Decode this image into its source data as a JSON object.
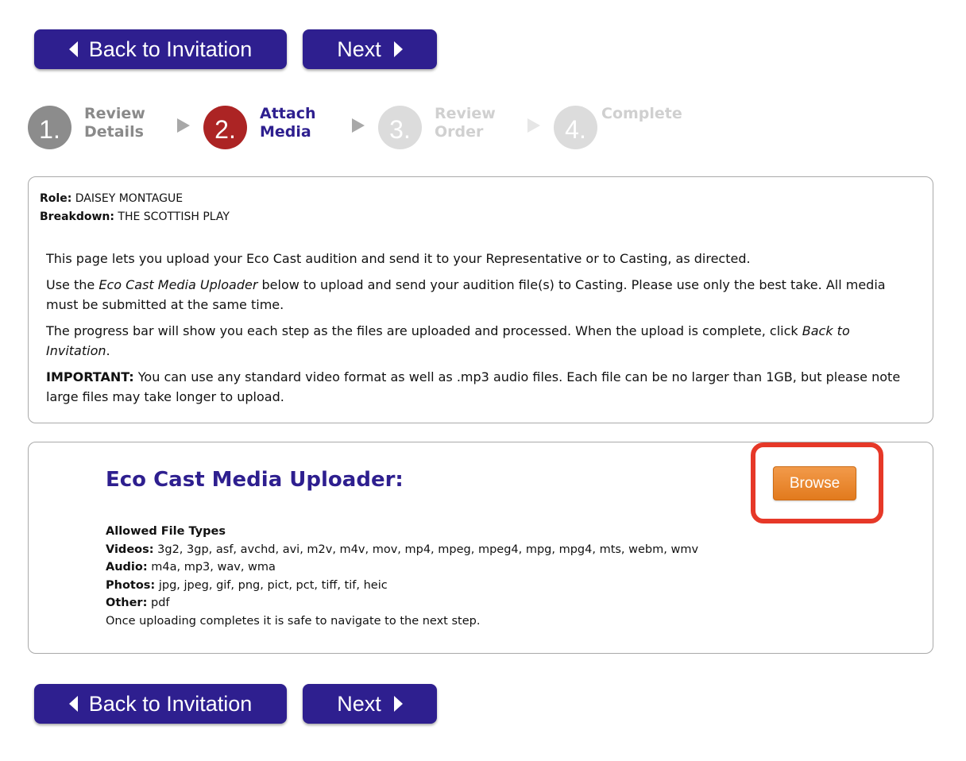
{
  "nav": {
    "back_label": "Back to Invitation",
    "next_label": "Next"
  },
  "steps": [
    {
      "number": "1.",
      "line1": "Review",
      "line2": "Details",
      "state": "done"
    },
    {
      "number": "2.",
      "line1": "Attach",
      "line2": "Media",
      "state": "active"
    },
    {
      "number": "3.",
      "line1": "Review",
      "line2": "Order",
      "state": "future"
    },
    {
      "number": "4.",
      "line1": "Complete",
      "line2": "",
      "state": "future"
    }
  ],
  "info": {
    "role_label": "Role:",
    "role_value": "DAISEY MONTAGUE",
    "breakdown_label": "Breakdown:",
    "breakdown_value": "THE SCOTTISH PLAY",
    "p1": "This page lets you upload your Eco Cast audition and send it to your Representative or to Casting, as directed.",
    "p2_pre": "Use the ",
    "p2_em": "Eco Cast Media Uploader",
    "p2_post": " below to upload and send your audition file(s) to Casting. Please use only the best take. All media must be submitted at the same time.",
    "p3_pre": "The progress bar will show you each step as the files are uploaded and processed. When the upload is complete, click ",
    "p3_em": "Back to Invitation",
    "p3_post": ".",
    "p4_bold": "IMPORTANT:",
    "p4_text": " You can use any standard video format as well as .mp3 audio files. Each file can be no larger than 1GB, but please note large files may take longer to upload."
  },
  "uploader": {
    "title": "Eco Cast Media Uploader:",
    "browse_label": "Browse",
    "allowed_heading": "Allowed File Types",
    "videos_label": "Videos:",
    "videos_value": " 3g2, 3gp, asf, avchd, avi, m2v, m4v, mov, mp4, mpeg, mpeg4, mpg, mpg4, mts, webm, wmv",
    "audio_label": "Audio:",
    "audio_value": " m4a, mp3, wav, wma",
    "photos_label": "Photos:",
    "photos_value": " jpg, jpeg, gif, png, pict, pct, tiff, tif, heic",
    "other_label": "Other:",
    "other_value": " pdf",
    "note": "Once uploading completes it is safe to navigate to the next step."
  },
  "colors": {
    "nav_button": "#2e1f8f",
    "step_done": "#8c8c8c",
    "step_active": "#ac2424",
    "step_future": "#dcdcdc",
    "browse_button": "#e88a33",
    "highlight": "#e63828"
  }
}
